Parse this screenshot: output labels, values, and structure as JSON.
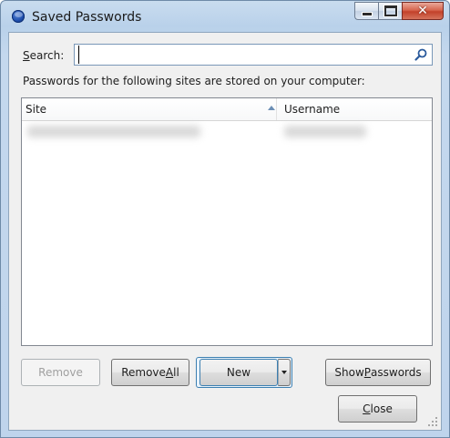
{
  "window": {
    "title": "Saved Passwords",
    "icon": "firefox-globe-icon"
  },
  "caption_buttons": {
    "minimize": "minimize-icon",
    "maximize": "maximize-icon",
    "close": "close-icon",
    "close_glyph": "✕"
  },
  "search": {
    "label_prefix": "",
    "label_accel": "S",
    "label_rest": "earch:",
    "value": "",
    "placeholder": "",
    "icon": "search-icon"
  },
  "info_text": "Passwords for the following sites are stored on your computer:",
  "list": {
    "columns": [
      "Site",
      "Username"
    ],
    "sort_icon": "sort-ascending-icon",
    "rows": [
      {
        "site": "",
        "username": "",
        "redacted": true
      }
    ]
  },
  "buttons": {
    "remove": "Remove",
    "remove_all_prefix": "Remove ",
    "remove_all_accel": "A",
    "remove_all_rest": "ll",
    "new": "New",
    "new_dropdown_icon": "dropdown-arrow-icon",
    "show_prefix": "Show ",
    "show_accel": "P",
    "show_rest": "asswords",
    "close_prefix": "",
    "close_accel": "C",
    "close_rest": "lose"
  },
  "colors": {
    "frame": "#bfd4ec",
    "client": "#f0f0f0",
    "close_button": "#c3412a",
    "focus_border": "#3c7fb1"
  }
}
